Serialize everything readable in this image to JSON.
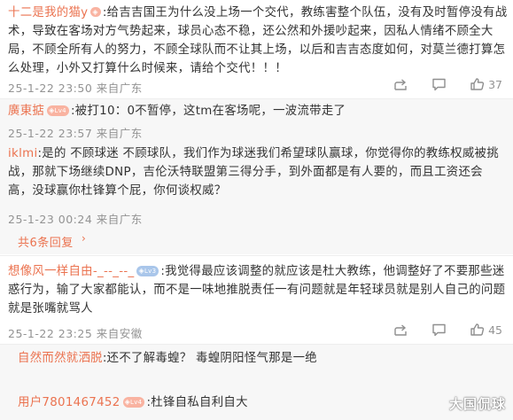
{
  "c1": {
    "user": "十二是我的猫y",
    "text": ":给吉吉国王为什么没上场一个交代，教练害整个队伍，没有及时暂停没有战术，导致在客场对方气势起来，球员心态不稳，还公然和外援吵起来，因私人情绪不顾全大局，不顾全所有人的努力，不顾全球队而不让其上场，以后和吉吉态度如何，对莫兰德打算怎么处理，小外又打算什么时候来，请给个交代！！！",
    "time": "25-1-22 23:50 来自广东",
    "likes": "37"
  },
  "r1": {
    "user": "廣東掂",
    "badge": "Lv4",
    "text": ":被打10：0不暂停，这tm在客场呢，一波流带走了",
    "time": "25-1-22 23:57 来自广东"
  },
  "r2": {
    "user": "iklmi",
    "text": ":是的 不顾球迷 不顾球队，我们作为球迷我们希望球队赢球，你觉得你的教练权威被挑战，那就下场继续DNP，吉伦沃特联盟第三得分手，到外面都是有人要的，而且工资还会高，没球赢你杜锋算个屁，你何谈权威？",
    "time": "25-1-23 00:24 来自广东"
  },
  "more_replies": "共6条回复",
  "c2": {
    "user": "想像风一样自由-_--_--_",
    "badge": "Lv3",
    "text": ":我觉得最应该调整的就应该是杜大教练，他调整好了不要那些迷惑行为，输了大家都能认，而不是一味地推脱责任一有问题就是年轻球员就是别人自己的问题就是张嘴就骂人",
    "time": "25-1-22 23:25 来自安徽",
    "likes": "45"
  },
  "r3": {
    "user": "自然而然就洒脱",
    "text": ":还不了解毒蝗？ 毒蝗阴阳怪气那是一绝"
  },
  "r4": {
    "user": "用户7801467452",
    "badge": "Lv4",
    "text": ":杜锋自私自利自大"
  },
  "watermark": "大国侃球",
  "colors": {
    "username": "#eb7350",
    "meta": "#939393",
    "reply_bg": "#f7f7f7"
  },
  "icons": [
    "share-icon",
    "comment-icon",
    "like-icon"
  ]
}
